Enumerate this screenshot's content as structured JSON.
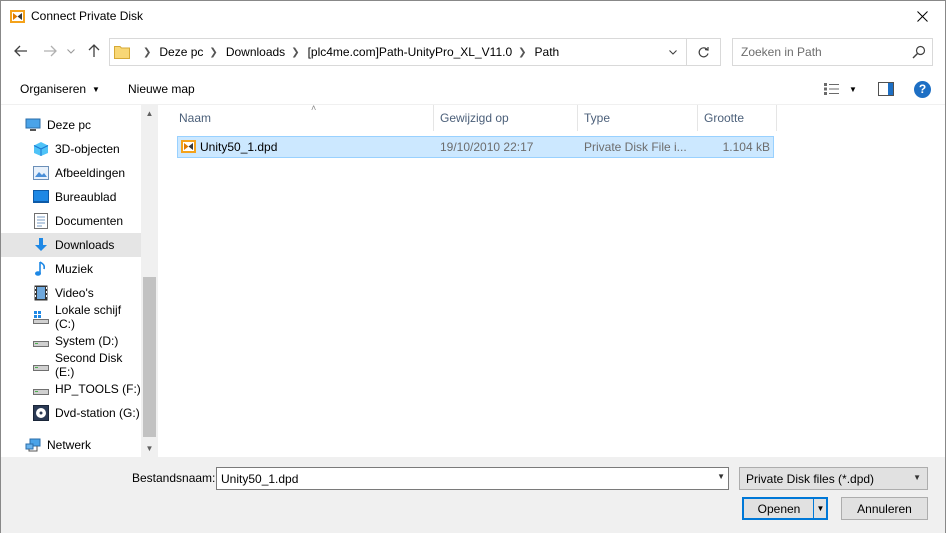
{
  "window": {
    "title": "Connect Private Disk"
  },
  "address": {
    "crumbs": [
      "Deze pc",
      "Downloads",
      "[plc4me.com]Path-UnityPro_XL_V11.0",
      "Path"
    ]
  },
  "search": {
    "placeholder": "Zoeken in Path"
  },
  "toolbar": {
    "organize_label": "Organiseren",
    "new_folder_label": "Nieuwe map",
    "help_label": "?"
  },
  "nav": {
    "items": [
      {
        "label": "Deze pc",
        "icon": "computer-icon"
      },
      {
        "label": "3D-objecten",
        "icon": "3d-objects-icon"
      },
      {
        "label": "Afbeeldingen",
        "icon": "pictures-icon"
      },
      {
        "label": "Bureaublad",
        "icon": "desktop-icon"
      },
      {
        "label": "Documenten",
        "icon": "documents-icon"
      },
      {
        "label": "Downloads",
        "icon": "downloads-icon",
        "selected": true
      },
      {
        "label": "Muziek",
        "icon": "music-icon"
      },
      {
        "label": "Video's",
        "icon": "videos-icon"
      },
      {
        "label": "Lokale schijf (C:)",
        "icon": "drive-icon"
      },
      {
        "label": "System (D:)",
        "icon": "drive-icon"
      },
      {
        "label": "Second Disk (E:)",
        "icon": "drive-icon"
      },
      {
        "label": "HP_TOOLS (F:)",
        "icon": "drive-icon"
      },
      {
        "label": "Dvd-station (G:)",
        "icon": "dvd-icon"
      },
      {
        "label": "Netwerk",
        "icon": "network-icon"
      }
    ]
  },
  "columns": {
    "name": "Naam",
    "modified": "Gewijzigd op",
    "type": "Type",
    "size": "Grootte"
  },
  "files": [
    {
      "name": "Unity50_1.dpd",
      "modified": "19/10/2010 22:17",
      "type": "Private Disk File i...",
      "size": "1.104 kB"
    }
  ],
  "bottom": {
    "filename_label": "Bestandsnaam:",
    "filename_value": "Unity50_1.dpd",
    "filter_value": "Private Disk files (*.dpd)",
    "open_label": "Openen",
    "cancel_label": "Annuleren"
  },
  "colors": {
    "selection": "#cce8ff",
    "accent": "#0078d7"
  }
}
